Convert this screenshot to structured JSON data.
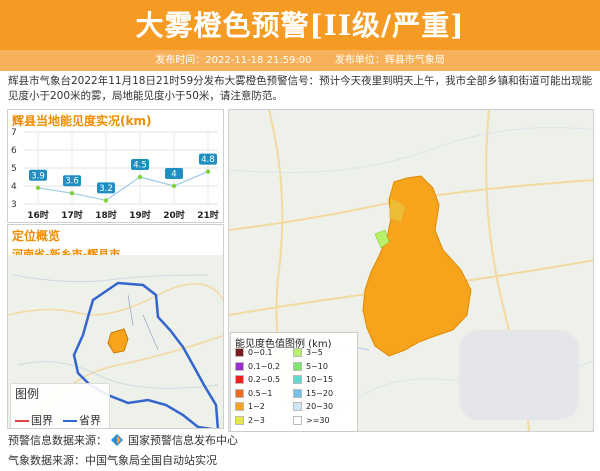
{
  "header": {
    "title": "大雾橙色预警[II级/严重]",
    "publish_time": "发布时间：2022-11-18 21:59:00",
    "publisher": "发布单位：辉县市气象局",
    "accent": "#f59a23"
  },
  "summary": "辉县市气象台2022年11月18日21时59分发布大雾橙色预警信号：预计今天夜里到明天上午，我市全部乡镇和街道可能出现能见度小于200米的雾，局地能见度小于50米，请注意防范。",
  "visibility_panel": {
    "title": "辉县当地能见度实况(km)",
    "y_ticks": [
      "7",
      "6",
      "5",
      "4",
      "3"
    ]
  },
  "chart_data": {
    "type": "line",
    "categories": [
      "16时",
      "17时",
      "18时",
      "19时",
      "20时",
      "21时"
    ],
    "values": [
      3.9,
      3.6,
      3.2,
      4.5,
      4,
      4.8
    ],
    "value_labels": [
      "3.9",
      "3.6",
      "3.2",
      "4.5",
      "4",
      "4.8"
    ],
    "title": "辉县当地能见度实况(km)",
    "ylim": [
      3,
      7
    ],
    "grid": true
  },
  "location": {
    "title": "定位概览",
    "region": "河南省-新乡市-辉县市",
    "legend_title": "图例",
    "legend_items": [
      "国界",
      "省界"
    ]
  },
  "vis_legend": {
    "title": "能见度色值图例 (km)",
    "items": [
      {
        "label": "0~0.1",
        "color": "#7b1c1c"
      },
      {
        "label": "3~5",
        "color": "#b8f06a"
      },
      {
        "label": "0.1~0.2",
        "color": "#9a2fd1"
      },
      {
        "label": "5~10",
        "color": "#78e86a"
      },
      {
        "label": "0.2~0.5",
        "color": "#e8231e"
      },
      {
        "label": "10~15",
        "color": "#5ad9d0"
      },
      {
        "label": "0.5~1",
        "color": "#f06a1e"
      },
      {
        "label": "15~20",
        "color": "#6fc1ee"
      },
      {
        "label": "1~2",
        "color": "#f7a41c"
      },
      {
        "label": "20~30",
        "color": "#cfe6f6"
      },
      {
        "label": "2~3",
        "color": "#e6e64a"
      },
      {
        "label": ">=30",
        "color": "#ffffff"
      }
    ]
  },
  "footer": {
    "warning_source": "预警信息数据来源：",
    "warning_source_name": "国家预警信息发布中心",
    "weather_source": "气象数据来源：中国气象局全国自动站实况"
  }
}
